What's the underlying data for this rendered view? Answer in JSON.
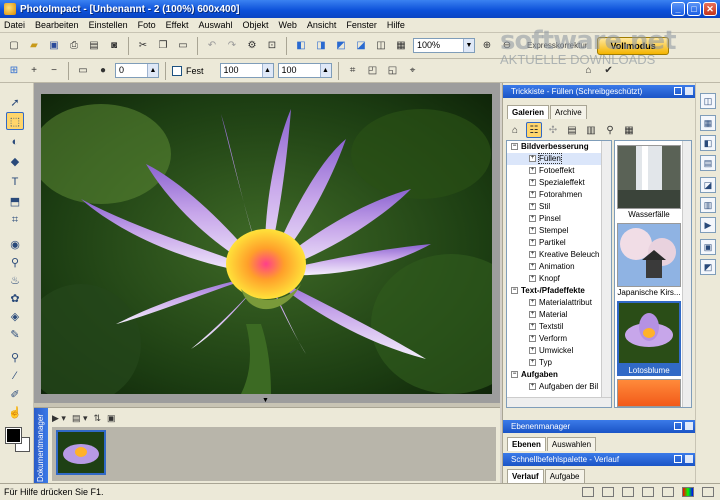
{
  "window": {
    "title": "PhotoImpact - [Unbenannt - 2 (100%) 600x400]",
    "controls": [
      "_",
      "□",
      "✕"
    ]
  },
  "menu": [
    "Datei",
    "Bearbeiten",
    "Einstellen",
    "Foto",
    "Effekt",
    "Auswahl",
    "Objekt",
    "Web",
    "Ansicht",
    "Fenster",
    "Hilfe"
  ],
  "toolbar1": {
    "zoom": "100%",
    "quickfix_label": "Expresskorrektur",
    "fullmode_label": "Vollmodus"
  },
  "toolbar2": {
    "angle": "0",
    "fest_label": "Fest",
    "width": "100",
    "height": "100"
  },
  "watermark": {
    "main": "software.net",
    "sub": "AKTUELLE DOWNLOADS"
  },
  "docmgr": {
    "tab_label": "Dokumentmanager"
  },
  "trickkiste": {
    "title": "Trickkiste - Füllen (Schreibgeschützt)",
    "tabs": [
      "Galerien",
      "Archive"
    ],
    "tree": [
      {
        "kind": "hdr",
        "label": "Bildverbesserung"
      },
      {
        "kind": "item",
        "label": "Füllen",
        "selected": true
      },
      {
        "kind": "item",
        "label": "Fotoeffekt"
      },
      {
        "kind": "item",
        "label": "Spezialeffekt"
      },
      {
        "kind": "item",
        "label": "Fotorahmen"
      },
      {
        "kind": "item",
        "label": "Stil"
      },
      {
        "kind": "item",
        "label": "Pinsel"
      },
      {
        "kind": "item",
        "label": "Stempel"
      },
      {
        "kind": "item",
        "label": "Partikel"
      },
      {
        "kind": "item",
        "label": "Kreative Beleuch"
      },
      {
        "kind": "item",
        "label": "Animation"
      },
      {
        "kind": "item",
        "label": "Knopf"
      },
      {
        "kind": "hdr",
        "label": "Text-/Pfadeffekte"
      },
      {
        "kind": "item",
        "label": "Materialattribut"
      },
      {
        "kind": "item",
        "label": "Material"
      },
      {
        "kind": "item",
        "label": "Textstil"
      },
      {
        "kind": "item",
        "label": "Verform"
      },
      {
        "kind": "item",
        "label": "Umwickel"
      },
      {
        "kind": "item",
        "label": "Typ"
      },
      {
        "kind": "hdr",
        "label": "Aufgaben"
      },
      {
        "kind": "item",
        "label": "Aufgaben der Bil"
      }
    ],
    "gallery": [
      "Wasserfälle",
      "Japanische Kirs...",
      "Lotosblume",
      ""
    ]
  },
  "ebenen": {
    "title": "Ebenenmanager",
    "tabs": [
      "Ebenen",
      "Auswahlen"
    ]
  },
  "schnell": {
    "title": "Schnellbefehlspalette - Verlauf",
    "tabs": [
      "Verlauf",
      "Aufgabe"
    ]
  },
  "status": {
    "text": "Für Hilfe drücken Sie F1."
  }
}
